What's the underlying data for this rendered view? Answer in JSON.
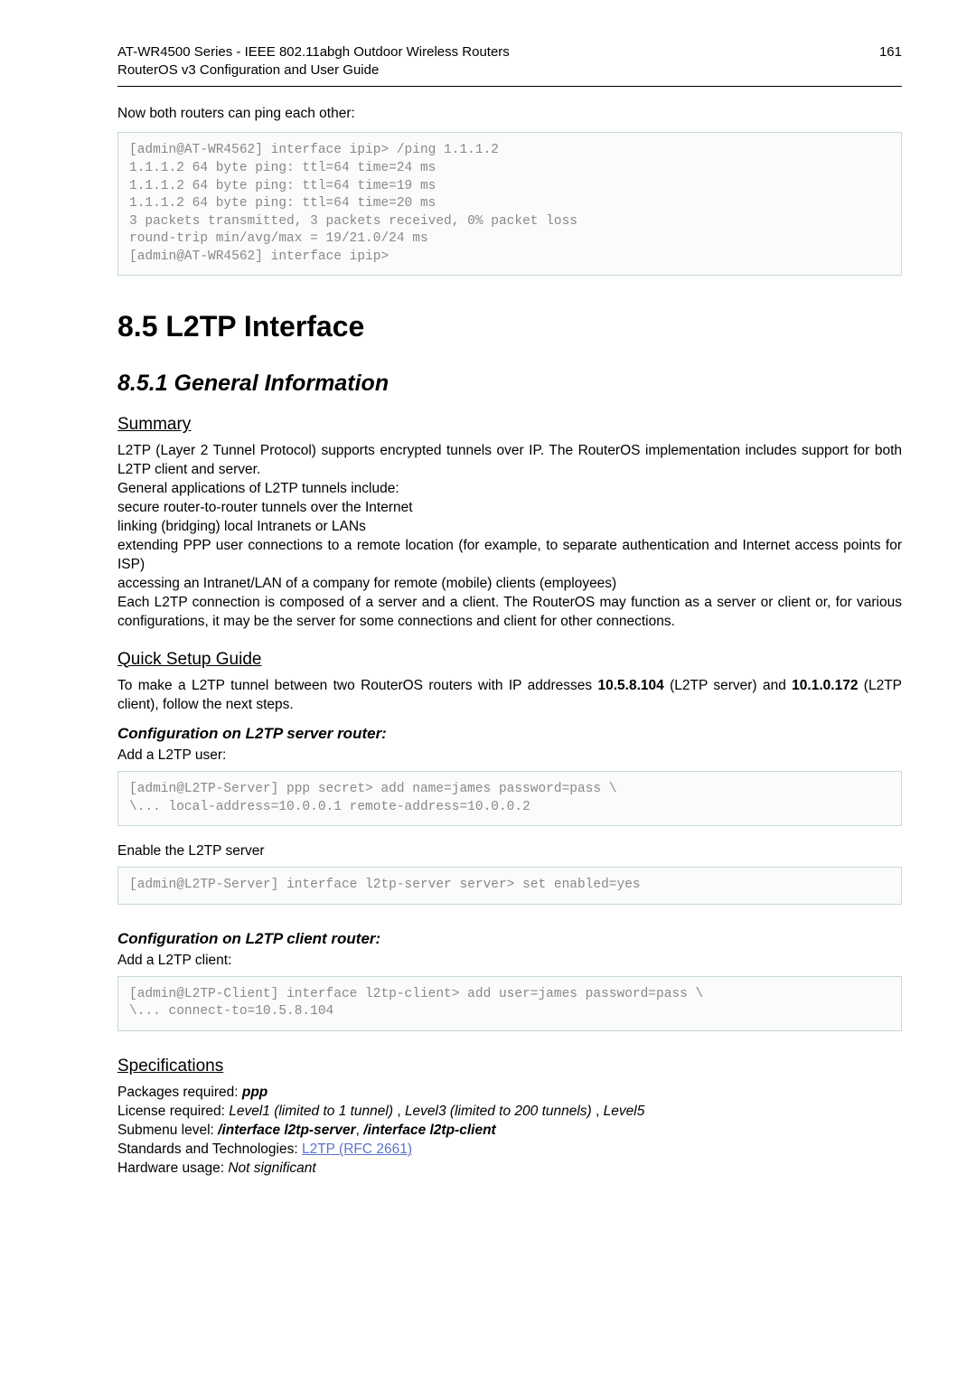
{
  "header": {
    "line1": "AT-WR4500 Series - IEEE 802.11abgh Outdoor Wireless Routers",
    "line2": "RouterOS v3 Configuration and User Guide",
    "pagenum": "161"
  },
  "intro_line": "Now both routers can ping each other:",
  "code1": "[admin@AT-WR4562] interface ipip> /ping 1.1.1.2\n1.1.1.2 64 byte ping: ttl=64 time=24 ms\n1.1.1.2 64 byte ping: ttl=64 time=19 ms\n1.1.1.2 64 byte ping: ttl=64 time=20 ms\n3 packets transmitted, 3 packets received, 0% packet loss\nround-trip min/avg/max = 19/21.0/24 ms\n[admin@AT-WR4562] interface ipip>",
  "h1": "8.5  L2TP Interface",
  "h2_1": "8.5.1  General Information",
  "h3_summary": "Summary",
  "summary": {
    "p1": "L2TP (Layer 2 Tunnel Protocol) supports encrypted tunnels over IP. The RouterOS implementation includes support for both L2TP client and server.",
    "p2": "General applications of L2TP tunnels include:",
    "p3": "secure router-to-router tunnels over the Internet",
    "p4": "linking (bridging) local Intranets or LANs",
    "p5": "extending PPP user connections to a remote location (for example, to separate authentication and Internet access points for ISP)",
    "p6": "accessing an Intranet/LAN of a company for remote (mobile) clients (employees)",
    "p7": "Each L2TP connection is composed of a server and a client. The RouterOS may function as a server or client or, for various configurations, it may be the server for some connections and client for other connections."
  },
  "h3_quick": "Quick Setup Guide",
  "quick": {
    "p1a": "To make a L2TP tunnel between two RouterOS routers with IP addresses ",
    "ip1": "10.5.8.104",
    "p1b": " (L2TP server) and ",
    "ip2": "10.1.0.172",
    "p1c": " (L2TP client), follow the next steps."
  },
  "h4_conf_server": "Configuration on L2TP server router:",
  "conf_server_line": "Add a L2TP user:",
  "code2": "[admin@L2TP-Server] ppp secret> add name=james password=pass \\\n\\... local-address=10.0.0.1 remote-address=10.0.0.2",
  "enable_line": "Enable the L2TP server",
  "code3": "[admin@L2TP-Server] interface l2tp-server server> set enabled=yes",
  "h4_conf_client": "Configuration on L2TP client router:",
  "conf_client_line": "Add a L2TP client:",
  "code4": "[admin@L2TP-Client] interface l2tp-client> add user=james password=pass \\\n\\... connect-to=10.5.8.104",
  "h3_specs": "Specifications",
  "specs": {
    "l1a": "Packages required: ",
    "l1b": "ppp",
    "l2a": "License required: ",
    "l2b": "Level1 (limited to 1 tunnel)",
    "l2c": " , ",
    "l2d": "Level3 (limited to 200 tunnels)",
    "l2e": " , ",
    "l2f": "Level5",
    "l3a": "Submenu level: ",
    "l3b": "/interface l2tp-server",
    "l3c": ", ",
    "l3d": "/interface l2tp-client",
    "l4a": "Standards and Technologies: ",
    "l4b": "L2TP (RFC 2661)",
    "l5a": "Hardware usage: ",
    "l5b": "Not significant"
  }
}
